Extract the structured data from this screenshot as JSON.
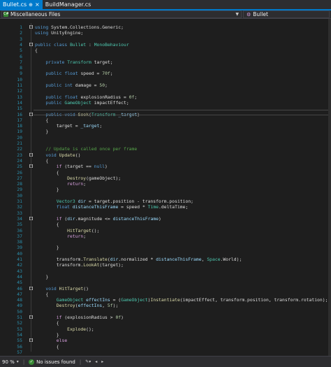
{
  "tabs": [
    {
      "label": "Bullet.cs",
      "pin": "⊕",
      "close": "×",
      "active": true
    },
    {
      "label": "BuildManager.cs",
      "active": false
    }
  ],
  "navbar": {
    "scope": "Miscellaneous Files",
    "class": "Bullet"
  },
  "status": {
    "zoom": "90 %",
    "issues": "No issues found"
  },
  "code_lines": [
    {
      "n": "1",
      "fold": true,
      "tokens": [
        [
          "kw",
          "using"
        ],
        [
          "pl",
          " System.Collections.Generic;"
        ]
      ]
    },
    {
      "n": "2",
      "tokens": [
        [
          "kw",
          "using"
        ],
        [
          "pl",
          " UnityEngine;"
        ]
      ]
    },
    {
      "n": "3",
      "tokens": []
    },
    {
      "n": "4",
      "fold": true,
      "tokens": [
        [
          "kw",
          "public"
        ],
        [
          "pl",
          " "
        ],
        [
          "kw",
          "class"
        ],
        [
          "pl",
          " "
        ],
        [
          "ty",
          "Bullet"
        ],
        [
          "pl",
          " : "
        ],
        [
          "ty",
          "MonoBehaviour"
        ]
      ]
    },
    {
      "n": "5",
      "tokens": [
        [
          "pl",
          "{"
        ]
      ]
    },
    {
      "n": "6",
      "tokens": []
    },
    {
      "n": "7",
      "tokens": [
        [
          "pl",
          "    "
        ],
        [
          "kw",
          "private"
        ],
        [
          "pl",
          " "
        ],
        [
          "ty",
          "Transform"
        ],
        [
          "pl",
          " target;"
        ]
      ]
    },
    {
      "n": "8",
      "tokens": []
    },
    {
      "n": "9",
      "tokens": [
        [
          "pl",
          "    "
        ],
        [
          "kw",
          "public"
        ],
        [
          "pl",
          " "
        ],
        [
          "kw",
          "float"
        ],
        [
          "pl",
          " speed = "
        ],
        [
          "nu",
          "70f"
        ],
        [
          "pl",
          ";"
        ]
      ]
    },
    {
      "n": "10",
      "tokens": []
    },
    {
      "n": "11",
      "tokens": [
        [
          "pl",
          "    "
        ],
        [
          "kw",
          "public"
        ],
        [
          "pl",
          " "
        ],
        [
          "kw",
          "int"
        ],
        [
          "pl",
          " damage = "
        ],
        [
          "nu",
          "50"
        ],
        [
          "pl",
          ";"
        ]
      ]
    },
    {
      "n": "12",
      "tokens": []
    },
    {
      "n": "13",
      "tokens": [
        [
          "pl",
          "    "
        ],
        [
          "kw",
          "public"
        ],
        [
          "pl",
          " "
        ],
        [
          "kw",
          "float"
        ],
        [
          "pl",
          " explosionRadius = "
        ],
        [
          "nu",
          "0f"
        ],
        [
          "pl",
          ";"
        ]
      ]
    },
    {
      "n": "14",
      "tokens": [
        [
          "pl",
          "    "
        ],
        [
          "kw",
          "public"
        ],
        [
          "pl",
          " "
        ],
        [
          "ty",
          "GameObject"
        ],
        [
          "pl",
          " impactEffect;"
        ]
      ]
    },
    {
      "n": "15",
      "tokens": []
    },
    {
      "n": "16",
      "fold": true,
      "tokens": [
        [
          "pl",
          "    "
        ],
        [
          "kw",
          "public"
        ],
        [
          "pl",
          " "
        ],
        [
          "kw",
          "void"
        ],
        [
          "pl",
          " "
        ],
        [
          "mt",
          "Seek"
        ],
        [
          "pl",
          "("
        ],
        [
          "ty",
          "Transform"
        ],
        [
          "pl",
          " "
        ],
        [
          "lv",
          "_target"
        ],
        [
          "pl",
          ")"
        ]
      ]
    },
    {
      "n": "17",
      "tokens": [
        [
          "pl",
          "    {"
        ]
      ]
    },
    {
      "n": "18",
      "tokens": [
        [
          "pl",
          "        target = "
        ],
        [
          "lv",
          "_target"
        ],
        [
          "pl",
          ";"
        ]
      ]
    },
    {
      "n": "19",
      "tokens": [
        [
          "pl",
          "    }"
        ]
      ]
    },
    {
      "n": "20",
      "tokens": []
    },
    {
      "n": "21",
      "tokens": []
    },
    {
      "n": "22",
      "tokens": [
        [
          "pl",
          "    "
        ],
        [
          "cm",
          "// Update is called once per frame"
        ]
      ]
    },
    {
      "n": "23",
      "fold": true,
      "tokens": [
        [
          "pl",
          "    "
        ],
        [
          "kw",
          "void"
        ],
        [
          "pl",
          " "
        ],
        [
          "mt",
          "Update"
        ],
        [
          "pl",
          "()"
        ]
      ]
    },
    {
      "n": "24",
      "tokens": [
        [
          "pl",
          "    {"
        ]
      ]
    },
    {
      "n": "25",
      "fold": true,
      "tokens": [
        [
          "pl",
          "        "
        ],
        [
          "ctl",
          "if"
        ],
        [
          "pl",
          " (target == "
        ],
        [
          "kw",
          "null"
        ],
        [
          "pl",
          ")"
        ]
      ]
    },
    {
      "n": "26",
      "tokens": [
        [
          "pl",
          "        {"
        ]
      ]
    },
    {
      "n": "27",
      "tokens": [
        [
          "pl",
          "            "
        ],
        [
          "mt",
          "Destroy"
        ],
        [
          "pl",
          "(gameObject);"
        ]
      ]
    },
    {
      "n": "28",
      "tokens": [
        [
          "pl",
          "            "
        ],
        [
          "ctl",
          "return"
        ],
        [
          "pl",
          ";"
        ]
      ]
    },
    {
      "n": "29",
      "tokens": [
        [
          "pl",
          "        }"
        ]
      ]
    },
    {
      "n": "30",
      "tokens": []
    },
    {
      "n": "31",
      "tokens": [
        [
          "pl",
          "        "
        ],
        [
          "ty",
          "Vector3"
        ],
        [
          "pl",
          " "
        ],
        [
          "lv",
          "dir"
        ],
        [
          "pl",
          " = target.position - transform.position;"
        ]
      ]
    },
    {
      "n": "32",
      "tokens": [
        [
          "pl",
          "        "
        ],
        [
          "kw",
          "float"
        ],
        [
          "pl",
          " "
        ],
        [
          "lv",
          "distanceThisFrame"
        ],
        [
          "pl",
          " = speed * "
        ],
        [
          "ty",
          "Time"
        ],
        [
          "pl",
          ".deltaTime;"
        ]
      ]
    },
    {
      "n": "33",
      "tokens": []
    },
    {
      "n": "34",
      "fold": true,
      "tokens": [
        [
          "pl",
          "        "
        ],
        [
          "ctl",
          "if"
        ],
        [
          "pl",
          " ("
        ],
        [
          "lv",
          "dir"
        ],
        [
          "pl",
          ".magnitude <= "
        ],
        [
          "lv",
          "distanceThisFrame"
        ],
        [
          "pl",
          ")"
        ]
      ]
    },
    {
      "n": "35",
      "tokens": [
        [
          "pl",
          "        {"
        ]
      ]
    },
    {
      "n": "36",
      "tokens": [
        [
          "pl",
          "            "
        ],
        [
          "mt",
          "HitTarget"
        ],
        [
          "pl",
          "();"
        ]
      ]
    },
    {
      "n": "37",
      "tokens": [
        [
          "pl",
          "            "
        ],
        [
          "ctl",
          "return"
        ],
        [
          "pl",
          ";"
        ]
      ]
    },
    {
      "n": "38",
      "tokens": []
    },
    {
      "n": "39",
      "tokens": [
        [
          "pl",
          "        }"
        ]
      ]
    },
    {
      "n": "40",
      "tokens": []
    },
    {
      "n": "41",
      "tokens": [
        [
          "pl",
          "        transform."
        ],
        [
          "mt",
          "Translate"
        ],
        [
          "pl",
          "("
        ],
        [
          "lv",
          "dir"
        ],
        [
          "pl",
          ".normalized * "
        ],
        [
          "lv",
          "distanceThisFrame"
        ],
        [
          "pl",
          ", "
        ],
        [
          "ty",
          "Space"
        ],
        [
          "pl",
          ".World);"
        ]
      ]
    },
    {
      "n": "42",
      "tokens": [
        [
          "pl",
          "        transform."
        ],
        [
          "mt",
          "LookAt"
        ],
        [
          "pl",
          "(target);"
        ]
      ]
    },
    {
      "n": "43",
      "tokens": []
    },
    {
      "n": "44",
      "tokens": [
        [
          "pl",
          "    }"
        ]
      ]
    },
    {
      "n": "45",
      "tokens": []
    },
    {
      "n": "46",
      "fold": true,
      "tokens": [
        [
          "pl",
          "    "
        ],
        [
          "kw",
          "void"
        ],
        [
          "pl",
          " "
        ],
        [
          "mt",
          "HitTarget"
        ],
        [
          "pl",
          "()"
        ]
      ]
    },
    {
      "n": "47",
      "tokens": [
        [
          "pl",
          "    {"
        ]
      ]
    },
    {
      "n": "48",
      "tokens": [
        [
          "pl",
          "        "
        ],
        [
          "ty",
          "GameObject"
        ],
        [
          "pl",
          " "
        ],
        [
          "lv",
          "effectIns"
        ],
        [
          "pl",
          " = ("
        ],
        [
          "ty",
          "GameObject"
        ],
        [
          "pl",
          ")"
        ],
        [
          "mt",
          "Instantiate"
        ],
        [
          "pl",
          "(impactEffect, transform.position, transform.rotation);"
        ]
      ]
    },
    {
      "n": "49",
      "tokens": [
        [
          "pl",
          "        "
        ],
        [
          "mt",
          "Destroy"
        ],
        [
          "pl",
          "("
        ],
        [
          "lv",
          "effectIns"
        ],
        [
          "pl",
          ", "
        ],
        [
          "nu",
          "5f"
        ],
        [
          "pl",
          ");"
        ]
      ]
    },
    {
      "n": "50",
      "tokens": []
    },
    {
      "n": "51",
      "fold": true,
      "tokens": [
        [
          "pl",
          "        "
        ],
        [
          "ctl",
          "if"
        ],
        [
          "pl",
          " (explosionRadius > "
        ],
        [
          "nu",
          "0f"
        ],
        [
          "pl",
          ")"
        ]
      ]
    },
    {
      "n": "52",
      "tokens": [
        [
          "pl",
          "        {"
        ]
      ]
    },
    {
      "n": "53",
      "tokens": [
        [
          "pl",
          "            "
        ],
        [
          "mt",
          "Explode"
        ],
        [
          "pl",
          "();"
        ]
      ]
    },
    {
      "n": "54",
      "tokens": [
        [
          "pl",
          "        }"
        ]
      ]
    },
    {
      "n": "55",
      "fold": true,
      "tokens": [
        [
          "pl",
          "        "
        ],
        [
          "ctl",
          "else"
        ]
      ]
    },
    {
      "n": "56",
      "tokens": [
        [
          "pl",
          "        {"
        ]
      ]
    },
    {
      "n": "57",
      "tokens": []
    }
  ]
}
